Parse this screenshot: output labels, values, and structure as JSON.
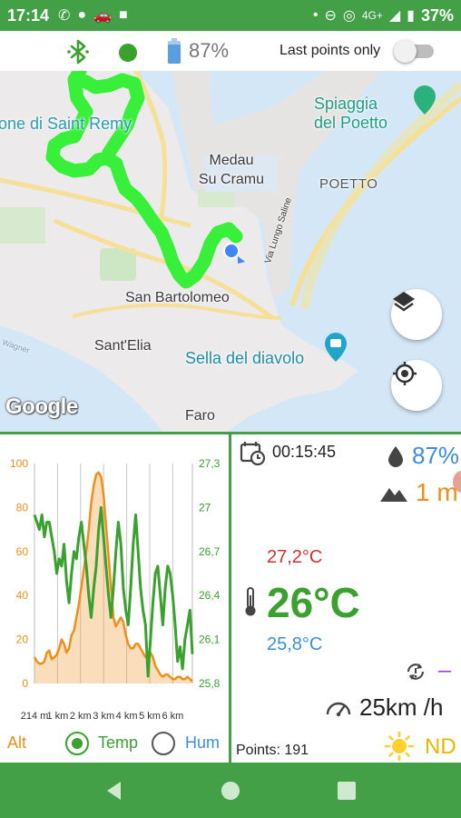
{
  "status_bar": {
    "time": "17:14",
    "network": "4G+",
    "battery": "37%",
    "icons": [
      "whatsapp-icon",
      "chat-bubble-icon",
      "car-icon",
      "video-icon",
      "dot-icon",
      "dnd-icon",
      "hotspot-icon",
      "signal-icon",
      "battery-icon"
    ]
  },
  "toolbar": {
    "bluetooth_icon": "bluetooth-icon",
    "connection_color": "#3aa12f",
    "battery_percent": "87%",
    "last_points_label": "Last points only",
    "last_points_on": false
  },
  "map": {
    "labels": {
      "saint_remy": "one di Saint Remy",
      "medau": "Medau\nSu Cramu",
      "spiaggia": "Spiaggia\ndel Poetto",
      "poetto": "POETTO",
      "san_bartolomeo": "San Bartolomeo",
      "sant_elia": "Sant'Elia",
      "sella": "Sella del diavolo",
      "faro": "Faro",
      "lungo": "Via Lungo Saline",
      "wagner": "Wagner"
    },
    "google": "Google",
    "track_color": "#38f03a",
    "buttons": [
      "layers-icon",
      "my-location-icon"
    ]
  },
  "chart_data": {
    "type": "line",
    "x_ticks": [
      "214 m",
      "1 km",
      "2 km",
      "3 km",
      "4 km",
      "5 km",
      "6 km"
    ],
    "left_axis": {
      "ticks": [
        "100",
        "80",
        "60",
        "40",
        "20",
        "0"
      ],
      "ylim": [
        0,
        100
      ],
      "color": "#ef8f1a",
      "label": "Alt"
    },
    "right_axis": {
      "ticks": [
        "27,3",
        "27",
        "26,7",
        "26,4",
        "26,1",
        "25,8"
      ],
      "ylim": [
        25.8,
        27.3
      ],
      "color": "#3aa12f",
      "label": "Temp"
    },
    "series": [
      {
        "name": "Alt",
        "axis": "left",
        "type": "area",
        "color": "#ef8f1a",
        "values": [
          12,
          10,
          9,
          9,
          10,
          14,
          15,
          11,
          12,
          13,
          16,
          20,
          18,
          14,
          16,
          22,
          24,
          30,
          36,
          44,
          52,
          60,
          70,
          82,
          90,
          95,
          96,
          94,
          86,
          72,
          58,
          44,
          30,
          26,
          28,
          30,
          28,
          22,
          18,
          16,
          16,
          18,
          18,
          16,
          14,
          12,
          14,
          14,
          12,
          8,
          6,
          4,
          3,
          4,
          4,
          3,
          2,
          2,
          3,
          3,
          2,
          2,
          3,
          2,
          1
        ]
      },
      {
        "name": "Temp",
        "axis": "right",
        "values": [
          26.95,
          26.9,
          26.85,
          26.95,
          26.8,
          26.9,
          26.9,
          26.8,
          26.7,
          26.55,
          26.65,
          26.6,
          26.75,
          26.5,
          26.35,
          26.55,
          26.7,
          26.65,
          26.8,
          26.9,
          26.75,
          26.6,
          26.4,
          26.25,
          26.45,
          26.6,
          26.85,
          27.0,
          26.8,
          26.6,
          26.4,
          26.25,
          26.45,
          26.7,
          26.9,
          26.75,
          26.45,
          26.3,
          26.2,
          26.45,
          26.75,
          26.95,
          26.7,
          26.45,
          26.3,
          26.2,
          25.85,
          26.1,
          26.35,
          26.55,
          26.6,
          26.4,
          26.2,
          26.45,
          26.6,
          26.55,
          26.4,
          26.2,
          25.95,
          26.05,
          25.9,
          26.1,
          26.2,
          26.3,
          26.0
        ]
      }
    ],
    "grid": true
  },
  "chart_legend": {
    "alt": "Alt",
    "temp": "Temp",
    "hum": "Hum",
    "selected": "temp"
  },
  "readings": {
    "elapsed": "00:15:45",
    "humidity": "87%",
    "altitude": "1 m",
    "temp_max": "27,2°C",
    "temp_current": "26°C",
    "temp_min": "25,8°C",
    "rotation_value": "---",
    "speed": "25km /h",
    "points": "Points: 191",
    "light": "ND"
  },
  "nav_bar": {
    "buttons": [
      "back-icon",
      "home-icon",
      "recents-icon"
    ]
  }
}
